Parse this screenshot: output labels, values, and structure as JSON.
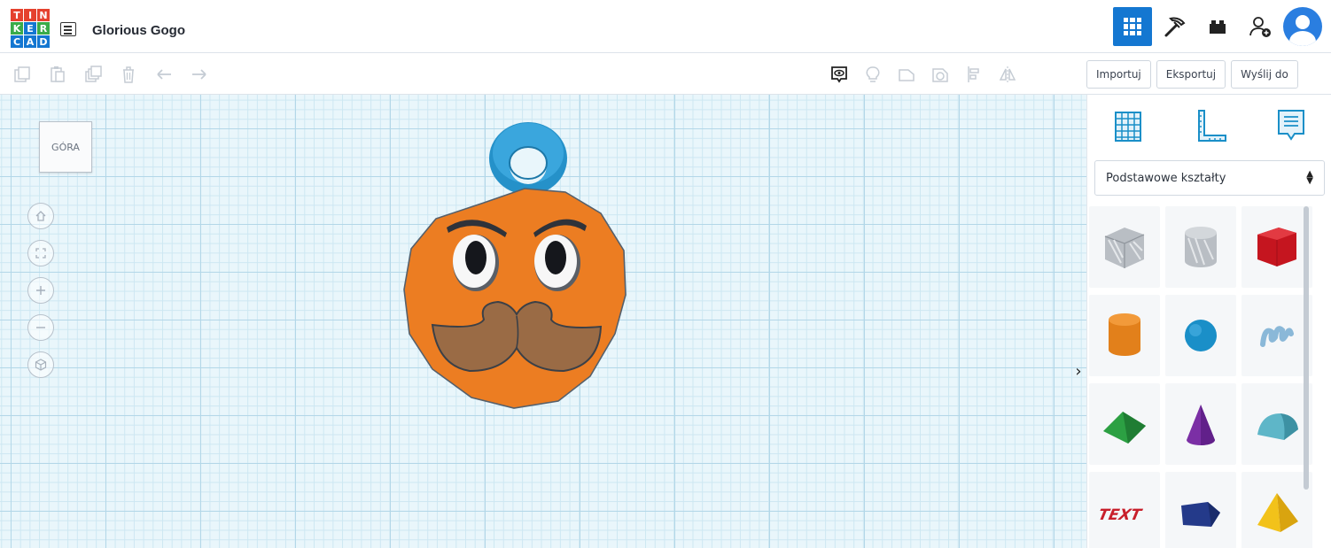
{
  "app": {
    "logo_letters": [
      "T",
      "I",
      "N",
      "K",
      "E",
      "R",
      "C",
      "A",
      "D"
    ],
    "logo_icon": "tinkercad-logo",
    "design_title": "Glorious Gogo"
  },
  "top_right": {
    "icons": [
      "3d-design-grid-icon",
      "minecraft-pickaxe-icon",
      "brick-icon",
      "add-user-icon",
      "avatar"
    ],
    "active_color": "#1477d1"
  },
  "toolbar": {
    "edit_icons": [
      "copy-icon",
      "paste-icon",
      "duplicate-icon",
      "delete-icon",
      "undo-icon",
      "redo-icon"
    ],
    "view_icons": [
      "show-notes-icon",
      "light-bulb-icon",
      "shape-icon",
      "hole-icon",
      "align-icon",
      "mirror-icon"
    ]
  },
  "actions": {
    "import_label": "Importuj",
    "export_label": "Eksportuj",
    "send_label": "Wyślij do"
  },
  "workplane": {
    "viewcube_label": "GÓRA",
    "view_controls": [
      "home-view-icon",
      "fit-view-icon",
      "zoom-in-icon",
      "zoom-out-icon",
      "ortho-perspective-icon"
    ],
    "colors": {
      "grid_major": "#b3d7e8",
      "grid_minor": "#cde7f2",
      "background": "#e9f6fb"
    }
  },
  "model": {
    "face_color": "#ec7d22",
    "loop_color": "#2591c9",
    "mustache_color": "#9a6b45"
  },
  "panel": {
    "tabs": [
      "workplane-grid-icon",
      "ruler-icon",
      "notes-icon"
    ],
    "category_selected": "Podstawowe kształty",
    "shape_label_text": "TEXT",
    "shapes": [
      {
        "name": "box-hole",
        "color": "#b9bec4"
      },
      {
        "name": "cylinder-hole",
        "color": "#b9bec4"
      },
      {
        "name": "box",
        "color": "#d0202a"
      },
      {
        "name": "cylinder",
        "color": "#e2801b"
      },
      {
        "name": "sphere",
        "color": "#1a8fc8"
      },
      {
        "name": "scribble",
        "color": "#8ab8d8"
      },
      {
        "name": "roof",
        "color": "#2ca043"
      },
      {
        "name": "cone",
        "color": "#7b2fa5"
      },
      {
        "name": "round-roof",
        "color": "#5eb6c8"
      },
      {
        "name": "text",
        "color": "#c81f2b"
      },
      {
        "name": "polygon",
        "color": "#243a8a"
      },
      {
        "name": "pyramid",
        "color": "#f2c21a"
      }
    ]
  }
}
